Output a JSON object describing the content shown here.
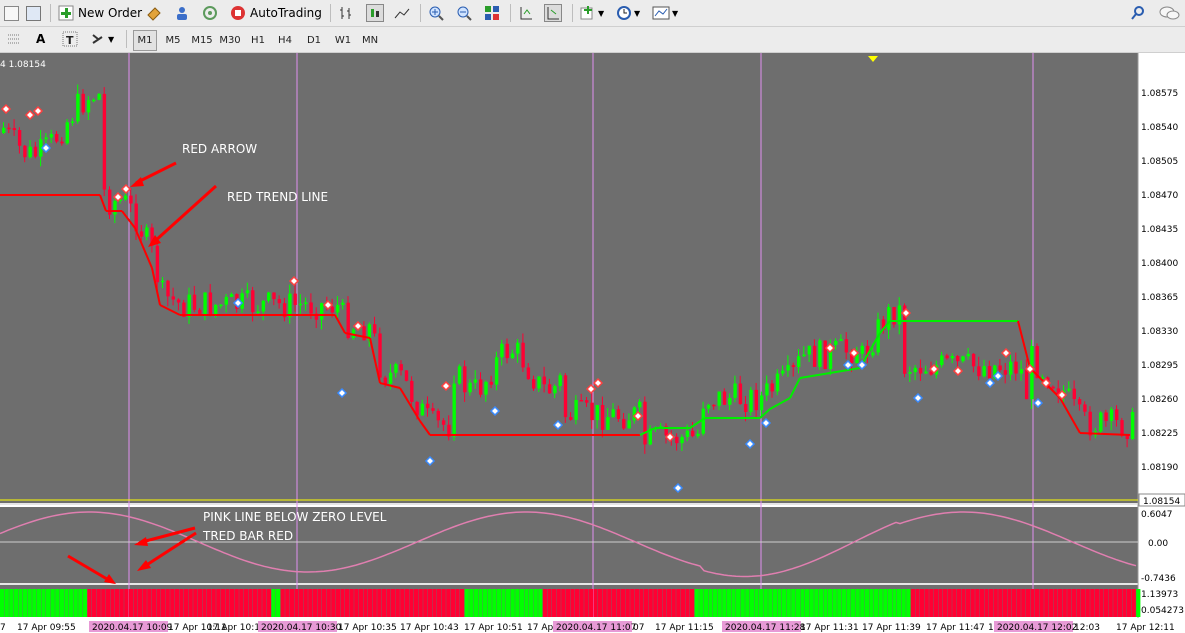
{
  "toolbar": {
    "new_order": "New Order",
    "autotrading": "AutoTrading",
    "timeframes": [
      "M1",
      "M5",
      "M15",
      "M30",
      "H1",
      "H4",
      "D1",
      "W1",
      "MN"
    ],
    "active_timeframe": "M1",
    "text_tool": "A"
  },
  "chart": {
    "info": "4 1.08154",
    "price_labels": [
      "1.08575",
      "1.08540",
      "1.08505",
      "1.08470",
      "1.08435",
      "1.08400",
      "1.08365",
      "1.08330",
      "1.08295",
      "1.08260",
      "1.08225",
      "1.08190"
    ],
    "current_price": "1.08154",
    "osc_labels": [
      "0.6047",
      "0.00",
      "-0.7436"
    ],
    "bar_labels": [
      "1.13973",
      "0.054273"
    ],
    "time_labels": [
      "7",
      "17 Apr 09:55",
      "17 Apr 10:11",
      "17 Apr 10:1",
      "17 Apr 10:35",
      "17 Apr 10:43",
      "17 Apr 10:51",
      "17 Ap",
      "07",
      "17 Apr 11:15",
      "17 Apr 11:31",
      "17 Apr 11:39",
      "17 Apr 11:47",
      "17 A",
      "12:03",
      "17 Apr 12:11"
    ],
    "time_labels_highlight": [
      "2020.04.17 10:09",
      "2020.04.17 10:30",
      "2020.04.17 11:07",
      "2020.04.17 11:28",
      "2020.04.17 12:02"
    ]
  },
  "annotations": {
    "red_arrow": "RED ARROW",
    "red_trend_line": "RED TREND LINE",
    "pink_line": "PINK LINE BELOW ZERO LEVEL",
    "tred_bar": "TRED BAR RED"
  },
  "colors": {
    "background": "#6e6e6e",
    "bull": "#00ff00",
    "bear": "#ff0033",
    "trend_red": "#ff0000",
    "trend_green": "#00ee00",
    "pink": "#e07fb0",
    "vline": "#e090f0",
    "current_line": "#ffff00"
  }
}
